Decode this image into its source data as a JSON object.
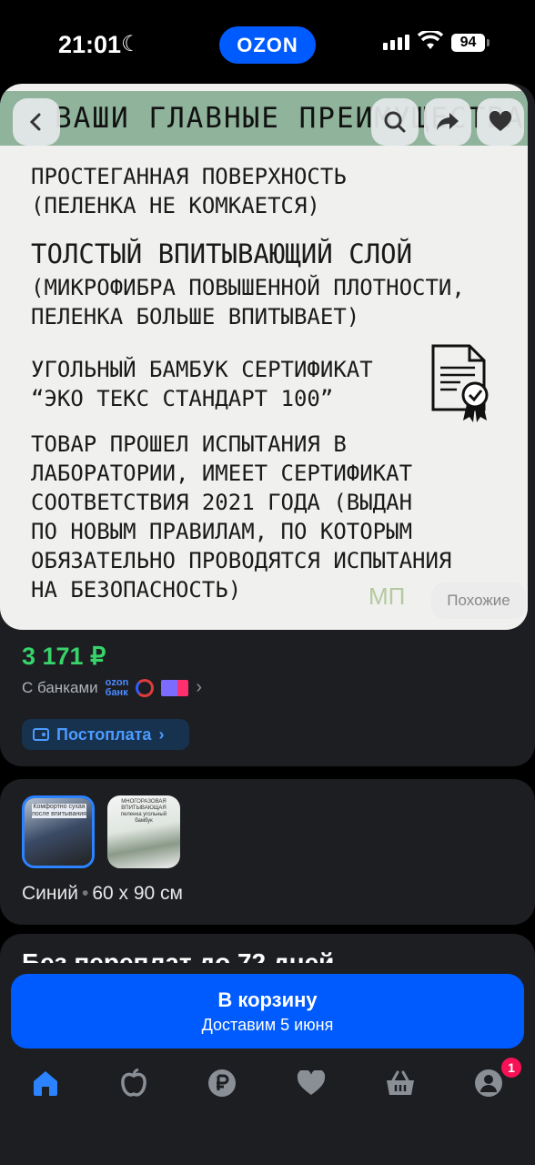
{
  "status_bar": {
    "time": "21:01",
    "brand": "OZON",
    "battery": "94"
  },
  "gallery": {
    "banner_text": "ВАШИ ГЛАВНЫЕ ПРЕИМУЩЕСТВА",
    "blocks": [
      {
        "text": "ПРОСТЕГАННАЯ ПОВЕРХНОСТЬ\n(ПЕЛЕНКА НЕ КОМКАЕТСЯ)"
      },
      {
        "title": "ТОЛСТЫЙ ВПИТЫВАЮЩИЙ СЛОЙ",
        "text": "(МИКРОФИБРА ПОВЫШЕННОЙ ПЛОТНОСТИ,\nПЕЛЕНКА БОЛЬШЕ ВПИТЫВАЕТ)"
      },
      {
        "text": "УГОЛЬНЫЙ БАМБУК СЕРТИФИКАТ\n“ЭКО ТЕКС СТАНДАРТ 100”"
      },
      {
        "text": "ТОВАР ПРОШЕЛ ИСПЫТАНИЯ  В\nЛАБОРАТОРИИ, ИМЕЕТ СЕРТИФИКАТ\nСООТВЕТСТВИЯ 2021 ГОДА (ВЫДАН\nПО НОВЫМ ПРАВИЛАМ, ПО КОТОРЫМ\nОБЯЗАТЕЛЬНО ПРОВОДЯТСЯ ИСПЫТАНИЯ\nНА БЕЗОПАСНОСТЬ)"
      }
    ],
    "similar_label": "Похожие",
    "logo_text": "МП"
  },
  "price": {
    "value": "3 171 ₽",
    "banks_label": "С банками",
    "ozon_bank_line1": "ozon",
    "ozon_bank_line2": "банк",
    "postpay_label": "Постоплата"
  },
  "variants": {
    "thumb1_caption": "Комфортно сухая после впитывания",
    "thumb2_caption": "МНОГОРАЗОВАЯ ВПИТЫВАЮЩАЯ пеленка угольный бамбук",
    "color": "Синий",
    "size": "60 х 90 см"
  },
  "delivery": {
    "title": "Без переплат до 72 дней"
  },
  "cart": {
    "title": "В корзину",
    "subtitle": "Доставим 5 июня"
  },
  "tabbar": {
    "profile_badge": "1"
  },
  "colors": {
    "accent": "#005bff",
    "price": "#38d36a",
    "badge": "#f91155"
  }
}
